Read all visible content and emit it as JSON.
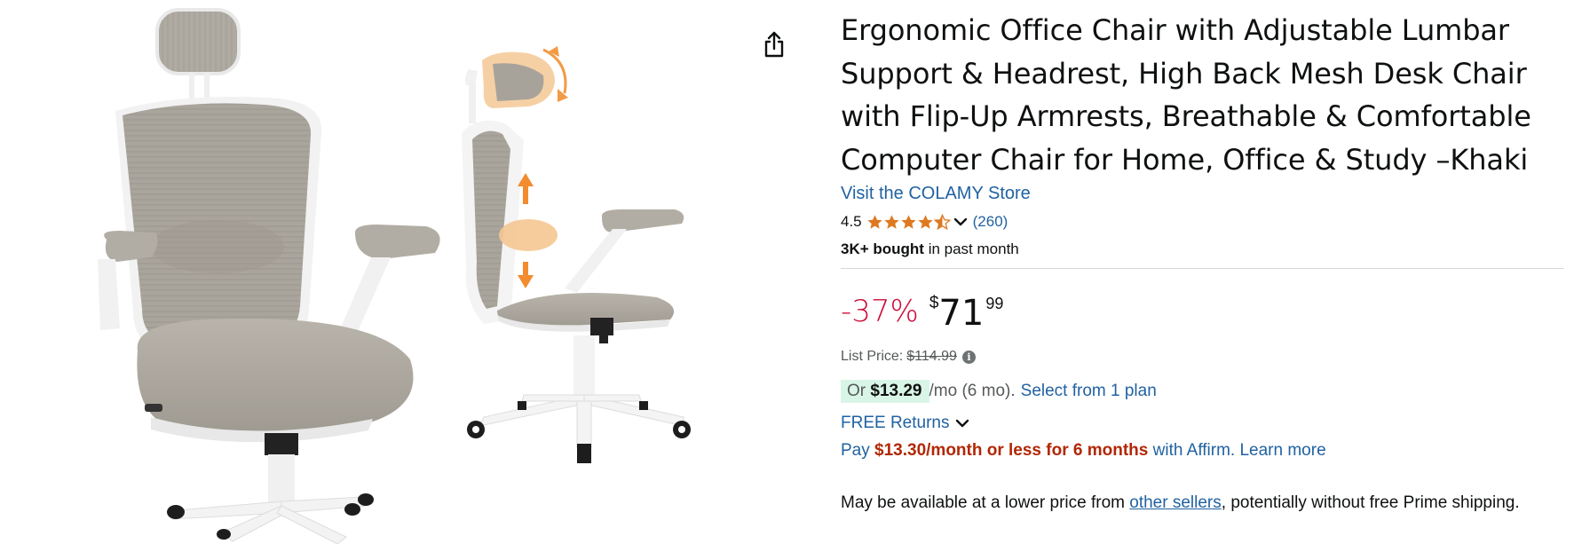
{
  "product": {
    "title_lines": [
      "Ergonomic Office Chair with Adjustable Lumbar",
      "Support & Headrest, High Back Mesh Desk Chair",
      "with Flip-Up Armrests, Breathable & Comfortable",
      "Computer Chair for Home, Office & Study –Khaki"
    ],
    "store_link": "Visit the COLAMY Store",
    "rating_value": "4.5",
    "rating_stars": 4.5,
    "rating_count": "(260)",
    "bought_bold": "3K+ bought",
    "bought_rest": " in past month"
  },
  "price": {
    "discount": "-37%",
    "currency": "$",
    "whole": "71",
    "fraction": "99",
    "list_label": "List Price:",
    "list_value": "$114.99"
  },
  "financing": {
    "or_label": "Or ",
    "monthly_amount": "$13.29",
    "monthly_term": " /mo (6 mo).",
    "select_plan": "Select from 1 plan",
    "returns": "FREE Returns",
    "affirm_prefix": "Pay ",
    "affirm_amount": "$13.30/month or less for 6 months",
    "affirm_suffix": " with Affirm.",
    "affirm_learn": "Learn more"
  },
  "availability": {
    "prefix": "May be available at a lower price from ",
    "link": "other sellers",
    "suffix": ", potentially without free Prime shipping."
  },
  "icons": {
    "share": "share-icon",
    "info": "info-icon",
    "chevron": "chevron-down-icon",
    "star": "star-icon"
  },
  "colors": {
    "link": "#2162a1",
    "discount": "#cc0c39",
    "affirm_red": "#b12704",
    "star": "#de7921",
    "badge_bg": "#d9f5e7",
    "mesh": "#a9a49b",
    "frame": "#f4f4f4"
  }
}
